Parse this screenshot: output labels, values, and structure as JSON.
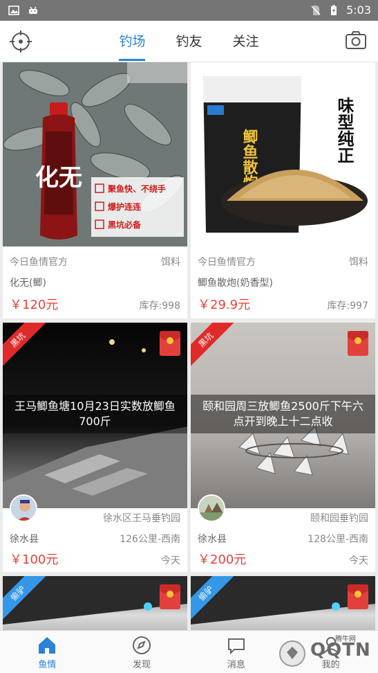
{
  "status_bar": {
    "time": "5:03"
  },
  "top_nav": {
    "tabs": [
      {
        "label": "钓场",
        "active": true
      },
      {
        "label": "钓友",
        "active": false
      },
      {
        "label": "关注",
        "active": false
      }
    ]
  },
  "products": [
    {
      "seller": "今日鱼情官方",
      "category": "饵料",
      "name": "化无(鲫)",
      "price": "￥120元",
      "stock": "库存:998",
      "image_texts": {
        "bottle_label": "化无",
        "bullets": [
          "聚鱼快、不绕手",
          "爆护连连",
          "黑坑必备"
        ]
      }
    },
    {
      "seller": "今日鱼情官方",
      "category": "饵料",
      "name": "鲫鱼散炮(奶香型)",
      "price": "￥29.9元",
      "stock": "库存:997",
      "image_texts": {
        "bag_title": "鲫鱼散炮",
        "side_text": "味型纯正"
      }
    }
  ],
  "spots": [
    {
      "badge": "黑坑",
      "badge_color": "#e02a2a",
      "title": "王马鲫鱼塘10月23日实数放鲫鱼700斤",
      "pond": "徐水区王马垂钓园",
      "county": "徐水县",
      "distance": "126公里-西南",
      "price": "￥100元",
      "date": "今天"
    },
    {
      "badge": "黑坑",
      "badge_color": "#e02a2a",
      "title": "颐和园周三放鲫鱼2500斤下午六点开到晚上十二点收",
      "pond": "颐和园垂钓园",
      "county": "徐水县",
      "distance": "128公里-西南",
      "price": "￥200元",
      "date": "今天"
    },
    {
      "badge": "偷驴",
      "badge_color": "#3597e8"
    },
    {
      "badge": "偷驴",
      "badge_color": "#3597e8"
    }
  ],
  "bottom_nav": [
    {
      "label": "鱼情",
      "active": true
    },
    {
      "label": "发现",
      "active": false
    },
    {
      "label": "消息",
      "active": false
    },
    {
      "label": "我的",
      "active": false
    }
  ],
  "watermark": {
    "text": "QQTN",
    "small": "腾牛网"
  },
  "colors": {
    "accent": "#2a82d6",
    "price": "#e8413b"
  }
}
